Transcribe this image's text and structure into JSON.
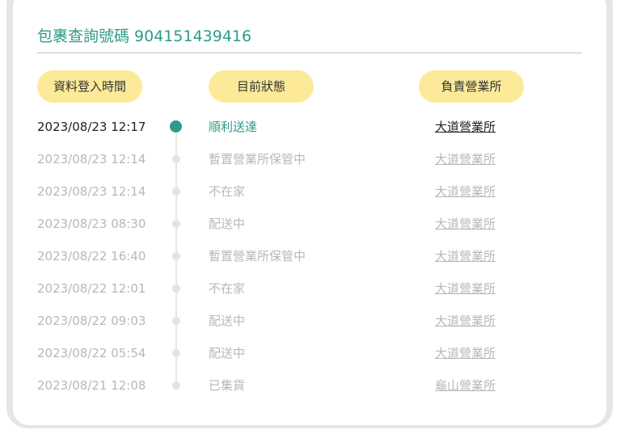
{
  "header": {
    "title": "包裹查詢號碼 904151439416"
  },
  "columns": {
    "time": "資料登入時間",
    "status": "目前狀態",
    "office": "負責營業所"
  },
  "colors": {
    "accent": "#2e9b8a",
    "pill": "#fdea99",
    "muted_text": "#b8b8b8"
  },
  "records": [
    {
      "time": "2023/08/23 12:17",
      "status": "順利送達",
      "office": "大道營業所",
      "current": true
    },
    {
      "time": "2023/08/23 12:14",
      "status": "暫置營業所保管中",
      "office": "大道營業所",
      "current": false
    },
    {
      "time": "2023/08/23 12:14",
      "status": "不在家",
      "office": "大道營業所",
      "current": false
    },
    {
      "time": "2023/08/23 08:30",
      "status": "配送中",
      "office": "大道營業所",
      "current": false
    },
    {
      "time": "2023/08/22 16:40",
      "status": "暫置營業所保管中",
      "office": "大道營業所",
      "current": false
    },
    {
      "time": "2023/08/22 12:01",
      "status": "不在家",
      "office": "大道營業所",
      "current": false
    },
    {
      "time": "2023/08/22 09:03",
      "status": "配送中",
      "office": "大道營業所",
      "current": false
    },
    {
      "time": "2023/08/22 05:54",
      "status": "配送中",
      "office": "大道營業所",
      "current": false
    },
    {
      "time": "2023/08/21 12:08",
      "status": "已集貨",
      "office": "龜山營業所",
      "current": false
    }
  ]
}
